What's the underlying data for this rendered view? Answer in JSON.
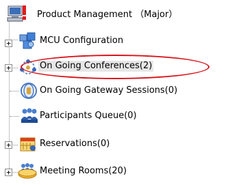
{
  "tree": {
    "root": {
      "label": "Product Management  （Major）",
      "icon": "server-warning-icon"
    },
    "items": [
      {
        "label": "MCU Configuration",
        "icon": "mcu-config-icon",
        "expandable": true,
        "expander": "+"
      },
      {
        "label": "On Going Conferences(2)",
        "icon": "conferences-icon",
        "expandable": true,
        "expander": "+",
        "selected": true
      },
      {
        "label": "On Going Gateway Sessions(0)",
        "icon": "gateway-icon",
        "expandable": false
      },
      {
        "label": "Participants Queue(0)",
        "icon": "participants-icon",
        "expandable": false
      },
      {
        "label": "Reservations(0)",
        "icon": "reservations-icon",
        "expandable": true,
        "expander": "+"
      },
      {
        "label": "Meeting Rooms(20)",
        "icon": "meeting-rooms-icon",
        "expandable": true,
        "expander": "+"
      }
    ]
  },
  "colors": {
    "highlight_ring": "#d9141b",
    "selection_bg": "#e6e6e6",
    "connector": "#8a8a8a"
  }
}
